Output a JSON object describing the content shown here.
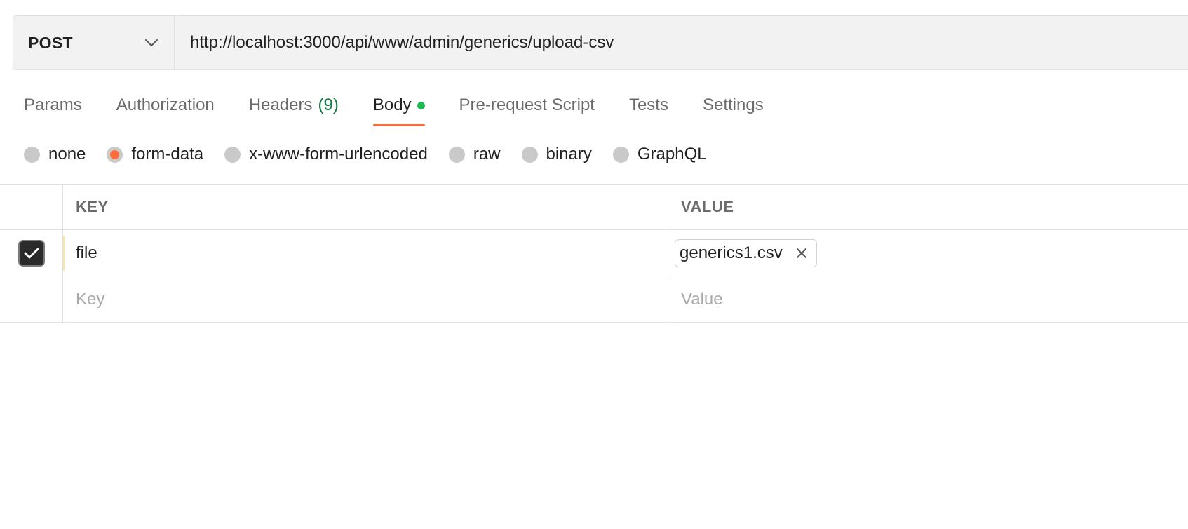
{
  "request": {
    "method": "POST",
    "url": "http://localhost:3000/api/www/admin/generics/upload-csv"
  },
  "tabs": [
    {
      "label": "Params"
    },
    {
      "label": "Authorization"
    },
    {
      "label": "Headers",
      "count": "(9)"
    },
    {
      "label": "Body",
      "active": true,
      "indicator": "green-dot"
    },
    {
      "label": "Pre-request Script"
    },
    {
      "label": "Tests"
    },
    {
      "label": "Settings"
    }
  ],
  "body_types": [
    {
      "label": "none",
      "checked": false
    },
    {
      "label": "form-data",
      "checked": true
    },
    {
      "label": "x-www-form-urlencoded",
      "checked": false
    },
    {
      "label": "raw",
      "checked": false
    },
    {
      "label": "binary",
      "checked": false
    },
    {
      "label": "GraphQL",
      "checked": false
    }
  ],
  "table": {
    "headers": {
      "key": "KEY",
      "value": "VALUE"
    },
    "rows": [
      {
        "checked": true,
        "key": "file",
        "value_file": "generics1.csv"
      }
    ],
    "new_row": {
      "key_placeholder": "Key",
      "value_placeholder": "Value"
    }
  },
  "colors": {
    "accent": "#ff6c37",
    "count_green": "#0f7b3e",
    "dot_green": "#1db954"
  },
  "icons": {
    "method_dropdown": "chevron-down-icon",
    "checkbox": "check-icon",
    "remove_file": "close-icon"
  }
}
